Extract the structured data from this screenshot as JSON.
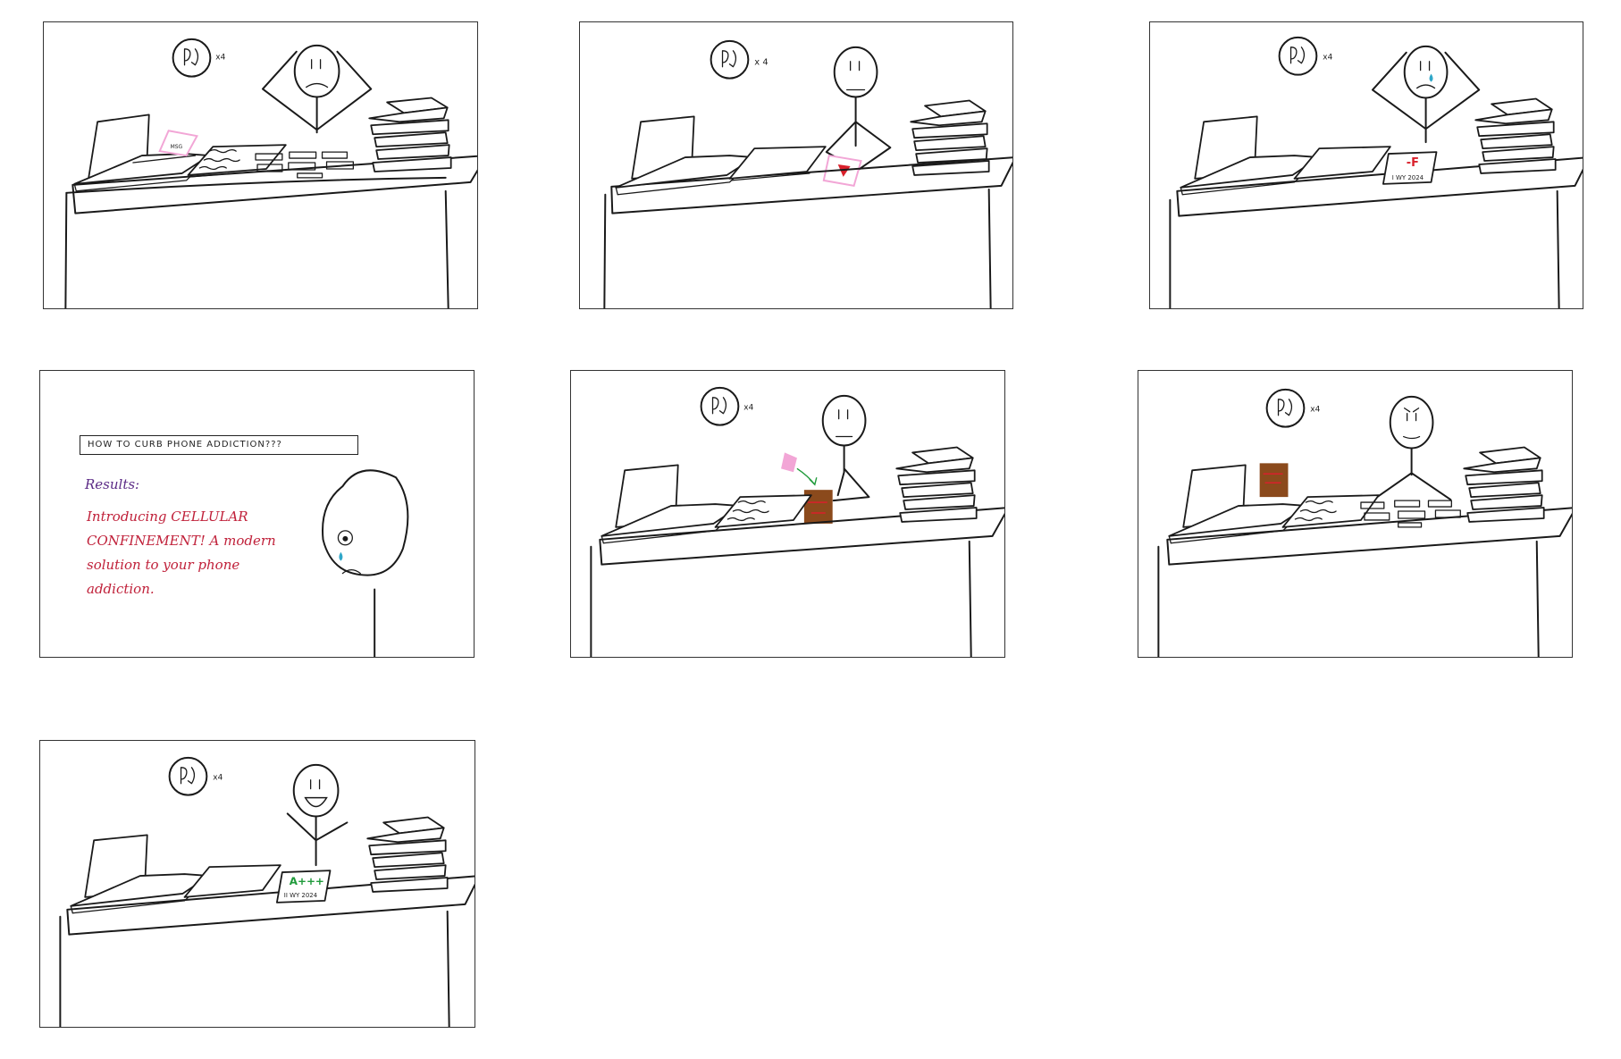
{
  "panels": [
    {
      "id": 1,
      "clock_multiplier": "x4"
    },
    {
      "id": 2,
      "clock_multiplier": "x 4"
    },
    {
      "id": 3,
      "clock_multiplier": "x4",
      "grade_text": "-F",
      "name_label": "I WY 2024"
    },
    {
      "id": 4,
      "search_query": "HOW TO CURB PHONE ADDICTION???",
      "results_label": "Results:",
      "ad_text": "Introducing CELLULAR CONFINEMENT! A modern solution to your phone addiction."
    },
    {
      "id": 5,
      "clock_multiplier": "x4"
    },
    {
      "id": 6,
      "clock_multiplier": "x4"
    },
    {
      "id": 7,
      "clock_multiplier": "x4",
      "grade_text": "A+++",
      "name_label": "II WY 2024"
    }
  ],
  "colors": {
    "ink": "#1a1a1a",
    "phone_pink": "#f2a6d6",
    "phone_red": "#d9202b",
    "tear_blue": "#2fa7c9",
    "box_brown": "#8b4a1c",
    "grade_red": "#d9202b",
    "grade_green": "#1f9a3a",
    "results_purple": "#5b2a86",
    "ad_red": "#c0213a"
  },
  "icons": [
    "clock-icon",
    "stick-figure",
    "laptop",
    "notebook",
    "book-stack",
    "desk",
    "phone",
    "tear-drop",
    "confinement-box"
  ]
}
